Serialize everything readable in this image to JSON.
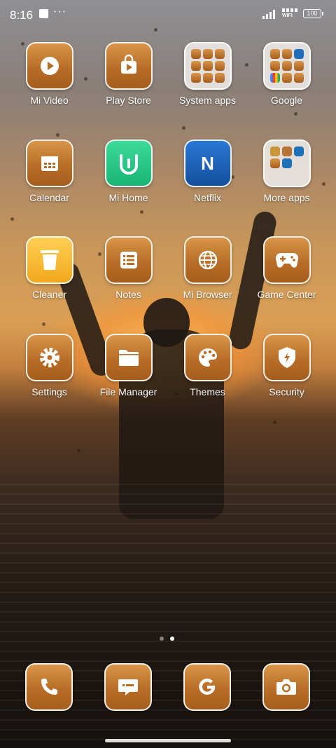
{
  "status": {
    "time": "8:16",
    "more": "···",
    "wifi_label": "WIFI",
    "battery": "100"
  },
  "home": {
    "rows": [
      [
        {
          "label": "Mi Video",
          "icon": "play-icon"
        },
        {
          "label": "Play Store",
          "icon": "play-store-icon"
        },
        {
          "label": "System apps",
          "icon": "folder-icon"
        },
        {
          "label": "Google",
          "icon": "folder-icon"
        }
      ],
      [
        {
          "label": "Calendar",
          "icon": "calendar-icon"
        },
        {
          "label": "Mi Home",
          "icon": "mi-home-icon"
        },
        {
          "label": "Netflix",
          "icon": "netflix-icon",
          "glyph": "N"
        },
        {
          "label": "More apps",
          "icon": "folder-icon"
        }
      ],
      [
        {
          "label": "Cleaner",
          "icon": "trash-icon"
        },
        {
          "label": "Notes",
          "icon": "notes-icon"
        },
        {
          "label": "Mi Browser",
          "icon": "globe-icon"
        },
        {
          "label": "Game Center",
          "icon": "gamepad-icon"
        }
      ],
      [
        {
          "label": "Settings",
          "icon": "gear-icon"
        },
        {
          "label": "File Manager",
          "icon": "folder-icon"
        },
        {
          "label": "Themes",
          "icon": "palette-icon"
        },
        {
          "label": "Security",
          "icon": "shield-icon"
        }
      ]
    ]
  },
  "pages": {
    "count": 2,
    "current": 2
  },
  "dock": [
    {
      "name": "phone",
      "icon": "phone-icon"
    },
    {
      "name": "messages",
      "icon": "message-icon"
    },
    {
      "name": "google",
      "icon": "google-icon"
    },
    {
      "name": "camera",
      "icon": "camera-icon"
    }
  ],
  "colors": {
    "tile_gradient_top": "#d9964a",
    "tile_gradient_bottom": "#a65d1c",
    "mi_home": "#17b476",
    "netflix": "#124f9c",
    "cleaner": "#f2a81c"
  }
}
